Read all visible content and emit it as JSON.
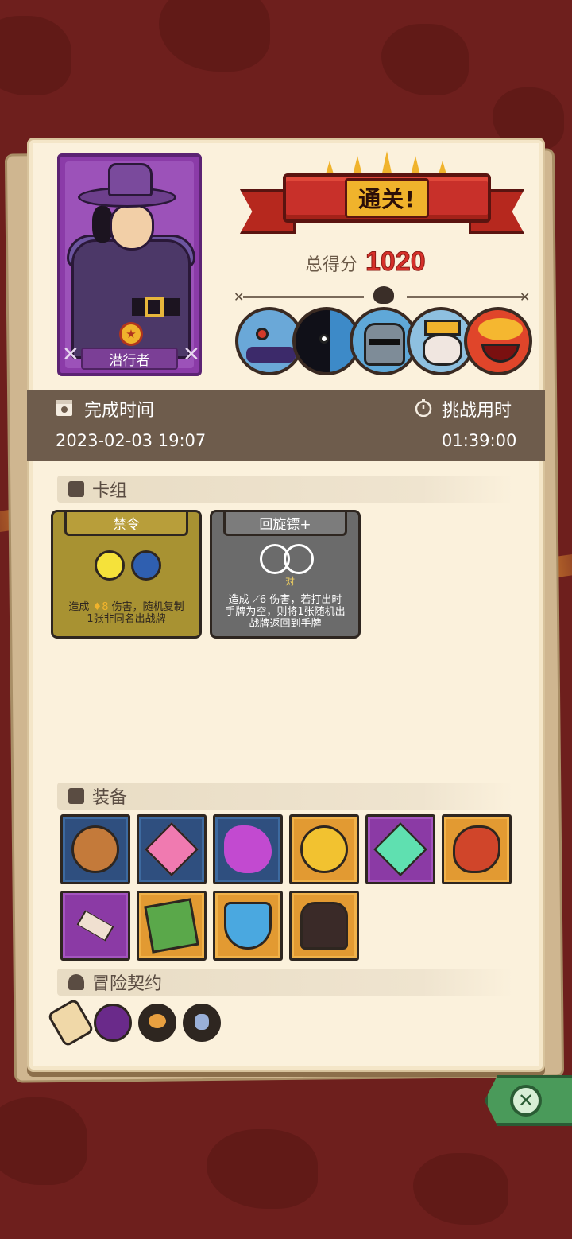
{
  "character": {
    "name": "潜行者"
  },
  "banner": {
    "title": "通关!"
  },
  "score": {
    "label": "总得分",
    "value": "1020"
  },
  "bosses": [
    {
      "name": "blue-ogre",
      "color": "#6aa8d8"
    },
    {
      "name": "shadow-beast",
      "color": "#3d8ac8"
    },
    {
      "name": "armored-knight",
      "color": "#5fa8d8"
    },
    {
      "name": "golden-skull-king",
      "color": "#8ec0e0"
    },
    {
      "name": "fire-demon",
      "color": "#e0452a"
    }
  ],
  "stats": {
    "finish_time_label": "完成时间",
    "finish_time_value": "2023-02-03 19:07",
    "challenge_time_label": "挑战用时",
    "challenge_time_value": "01:39:00"
  },
  "deck": {
    "section_title": "卡组",
    "cards": [
      {
        "title": "禁令",
        "desc_line1_prefix": "造成",
        "desc_damage": "8",
        "desc_line1_suffix": "伤害，随机复制",
        "desc_line2": "1张非同名出战牌",
        "color": "#a89232"
      },
      {
        "title": "回旋镖+",
        "pair_label": "一对",
        "desc_line1_prefix": "造成",
        "desc_damage": "6",
        "desc_line1_suffix": "伤害，若打出时",
        "desc_line2": "手牌为空，则将1张随机出",
        "desc_line3": "战牌返回到手牌",
        "color": "#6b6b6b"
      }
    ]
  },
  "equipment": {
    "section_title": "装备",
    "items": [
      {
        "name": "compass-shield",
        "rarity": "blue"
      },
      {
        "name": "pink-crystal",
        "rarity": "blue"
      },
      {
        "name": "purple-splash",
        "rarity": "blue"
      },
      {
        "name": "gold-coin",
        "rarity": "orange"
      },
      {
        "name": "green-gem",
        "rarity": "purple"
      },
      {
        "name": "roast-meat",
        "rarity": "orange"
      },
      {
        "name": "cross-bone-charm",
        "rarity": "purple"
      },
      {
        "name": "mossy-brick",
        "rarity": "orange"
      },
      {
        "name": "blue-crest-shield",
        "rarity": "orange"
      },
      {
        "name": "bat-cloak",
        "rarity": "orange"
      }
    ]
  },
  "contracts": {
    "section_title": "冒险契约",
    "items": [
      "scroll",
      "purple-star-seal",
      "roast-plate",
      "skull-seal"
    ]
  }
}
